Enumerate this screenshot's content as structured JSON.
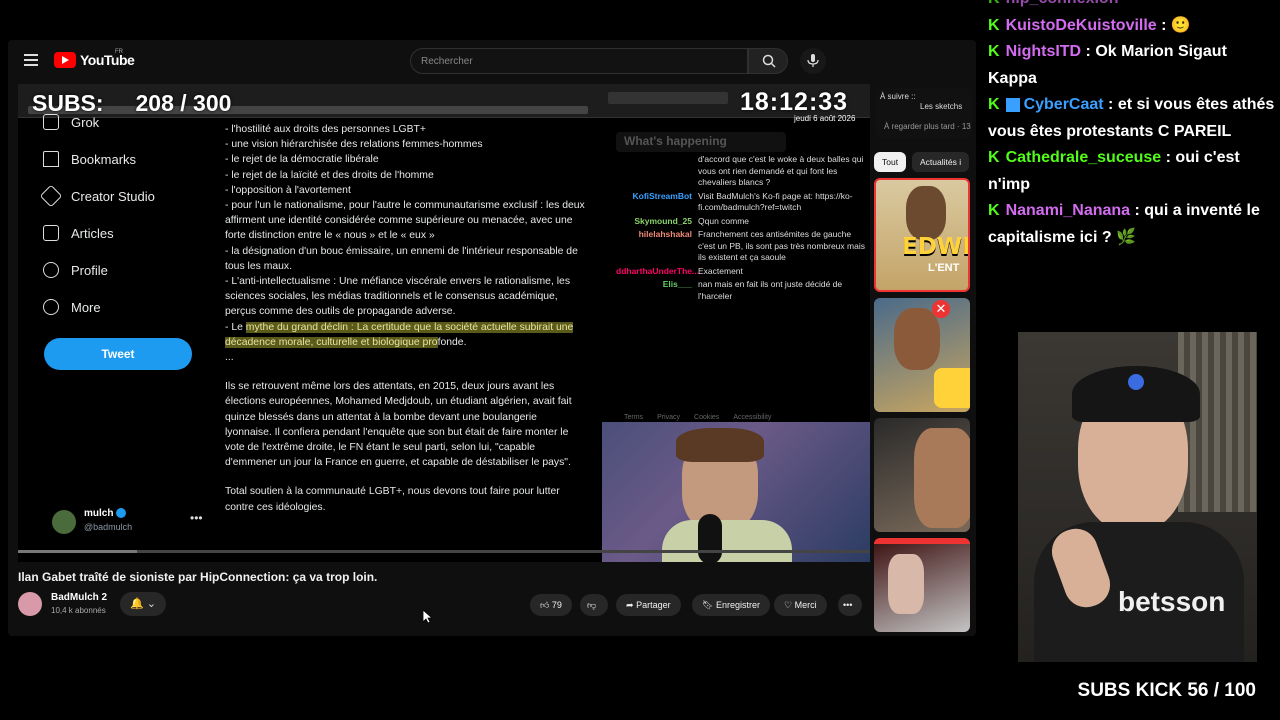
{
  "youtube": {
    "logo_text": "YouTube",
    "logo_region": "FR",
    "search_placeholder": "Rechercher",
    "video": {
      "title": "Ilan Gabet traîté de sioniste par HipConnection: ça va trop loin.",
      "channel": "BadMulch 2",
      "subscribers": "10,4 k abonnés",
      "likes": "79",
      "share_label": "Partager",
      "save_label": "Enregistrer",
      "thanks_label": "Merci"
    },
    "sidebar": {
      "up_next_label": "À suivre ::",
      "up_next_title": "Les sketchs",
      "up_next_sub": "À regarder plus tard · 13",
      "chip_all": "Tout",
      "chip_news": "Actualités i",
      "thumb1_text": "EDWIN",
      "thumb1_sub": "L'ENT"
    }
  },
  "overlay": {
    "subs_label": "SUBS:",
    "subs_value": "208 / 300",
    "clock": "18:12:33",
    "date": "jeudi 6 août 2026",
    "subs_kick": "SUBS KICK 56 / 100"
  },
  "twitter": {
    "nav": [
      "Grok",
      "Bookmarks",
      "Creator Studio",
      "Articles",
      "Profile",
      "More"
    ],
    "tweet_button": "Tweet",
    "profile_name": "mulch",
    "profile_handle": "@badmulch",
    "text_lines": [
      "- l'hostilité aux droits des personnes LGBT+",
      "- une vision hiérarchisée des relations femmes-hommes",
      "- le rejet de la démocratie libérale",
      "- le rejet de la laïcité et des droits de l'homme",
      "- l'opposition à l'avortement",
      "- pour l'un le nationalisme, pour l'autre le communautarisme exclusif : les deux affirment une identité considérée comme supérieure ou menacée, avec une forte distinction entre le « nous » et le « eux »",
      "- la désignation d'un bouc émissaire, un ennemi de l'intérieur responsable de tous les maux.",
      "- L'anti-intellectualisme : Une méfiance viscérale envers le rationalisme, les sciences sociales, les médias traditionnels et le consensus académique, perçus comme des outils de propagande adverse."
    ],
    "highlight_prefix": "- Le ",
    "highlight_text": "mythe du grand déclin : La certitude que la société actuelle subirait une décadence morale, culturelle et biologique pro",
    "highlight_suffix": "fonde.",
    "ellipsis": "...",
    "paragraph1": "Ils se retrouvent même lors des attentats, en 2015, deux jours avant les élections européennes, Mohamed Medjdoub, un étudiant algérien, avait fait quinze blessés dans un attentat à la bombe devant une boulangerie lyonnaise. Il confiera pendant l'enquête que son but était de faire monter le vote de l'extrême droite, le FN étant le seul parti, selon lui, \"capable d'emmener un jour la France en guerre, et capable de déstabiliser le pays\".",
    "paragraph2": "Total soutien à la communauté LGBT+, nous devons tout faire pour lutter contre ces idéologies.",
    "whats_happening": "What's happening",
    "footer_links": [
      "Terms",
      "Privacy",
      "Cookies",
      "Accessibility"
    ]
  },
  "inner_chat": [
    {
      "user": "",
      "msg": "d'accord que c'est le woke à deux balles qui vous ont rien demandé et qui font les chevaliers blancs ?"
    },
    {
      "user": "KofiStreamBot",
      "msg": "Visit BadMulch's Ko-fi page at: https://ko-fi.com/badmulch?ref=twitch"
    },
    {
      "user": "Skymound_25",
      "msg": "Qqun comme"
    },
    {
      "user": "hilelahshakal",
      "msg": "Franchement ces antisémites de gauche c'est un PB, ils sont pas très nombreux mais ils existent et ça saoule"
    },
    {
      "user": "ddharthaUnderThe...",
      "msg": "Exactement"
    },
    {
      "user": "Elis___",
      "msg": "nan mais en fait ils ont juste décidé de l'harceler"
    }
  ],
  "kick_chat": [
    {
      "user": "hip_connexion",
      "user_color": "#d36cf0",
      "msg": ""
    },
    {
      "user": "KuistoDeKuistoville",
      "user_color": "#d36cf0",
      "msg": " : 🙂"
    },
    {
      "user": "NightsITD",
      "user_color": "#d36cf0",
      "msg": " : Ok Marion Sigaut Kappa"
    },
    {
      "user": "CyberCaat",
      "user_color": "#3aa0ff",
      "msg": " : et si vous êtes athés vous êtes protestants C PAREIL"
    },
    {
      "user": "Cathedrale_suceuse",
      "user_color": "#53fc18",
      "msg": " : oui c'est n'imp"
    },
    {
      "user": "Nanami_Nanana",
      "user_color": "#d36cf0",
      "msg": " : qui a inventé le capitalisme ici ? 🌿"
    }
  ],
  "colors": {
    "kick_green": "#53fc18",
    "twitter_blue": "#1d9bf0",
    "youtube_red": "#ff0000"
  }
}
